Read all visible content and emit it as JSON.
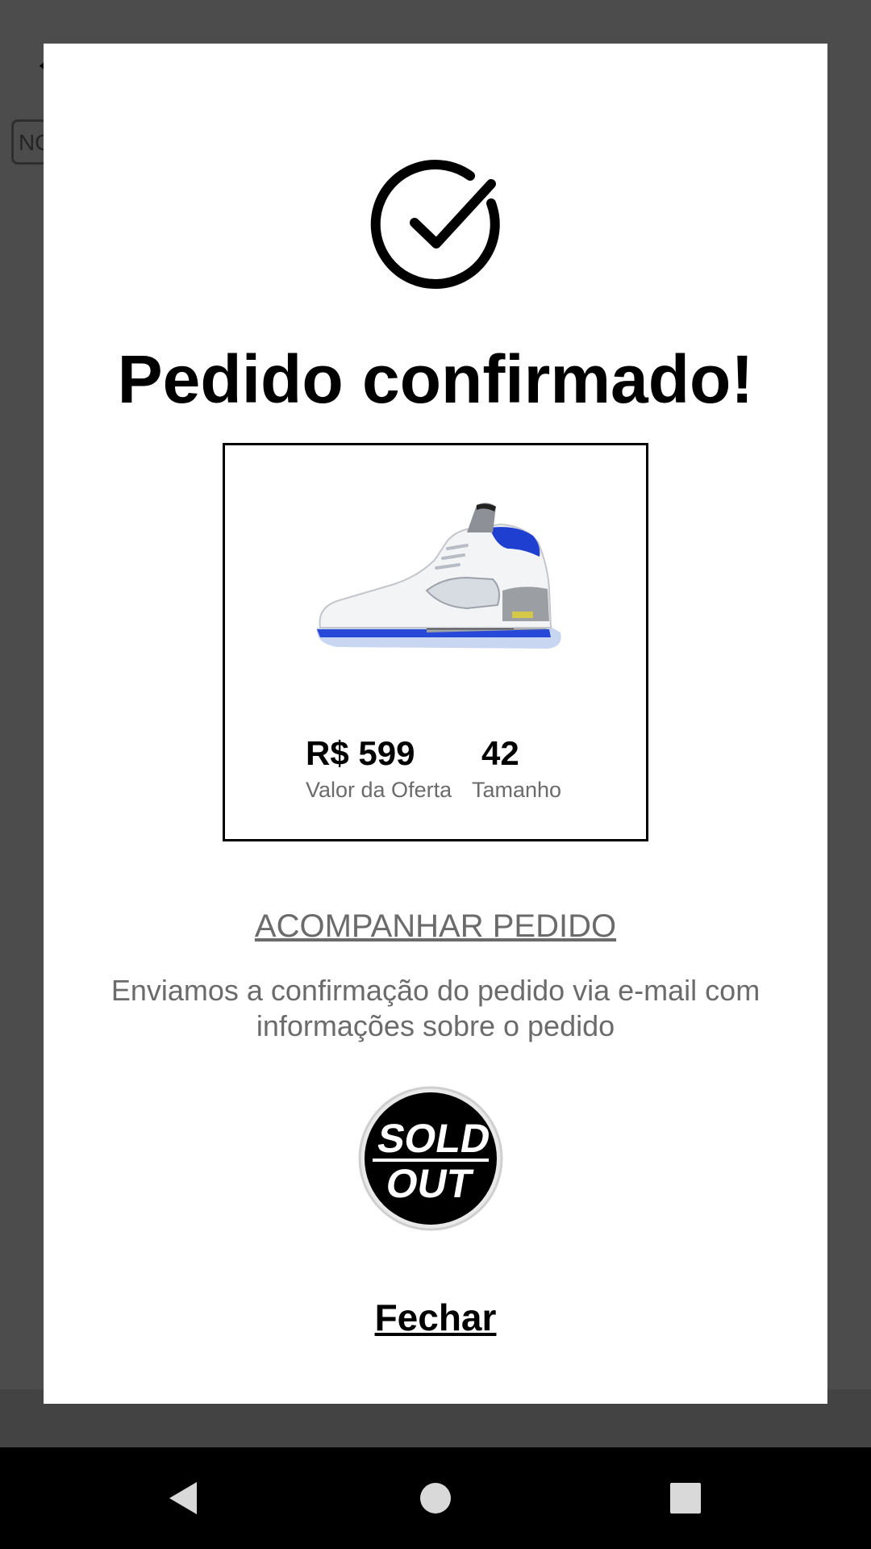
{
  "background": {
    "chip_text": "NO"
  },
  "modal": {
    "title": "Pedido confirmado!",
    "product": {
      "price": "R$ 599",
      "price_label": "Valor da Oferta",
      "size": "42",
      "size_label": "Tamanho"
    },
    "track_link": "ACOMPANHAR PEDIDO",
    "description": "Enviamos a confirmação do pedido via e-mail com informações sobre o pedido",
    "logo_text": [
      "SOLD",
      "OUT"
    ],
    "close_label": "Fechar"
  },
  "icons": {
    "confirm": "check-circle-icon",
    "nav_back": "triangle-back-icon",
    "nav_home": "circle-home-icon",
    "nav_recent": "square-recent-icon"
  },
  "colors": {
    "scrim": "#4a4a4a",
    "text_primary": "#000000",
    "text_secondary": "#6b6b6b",
    "shoe_accent": "#1f3fd1"
  }
}
